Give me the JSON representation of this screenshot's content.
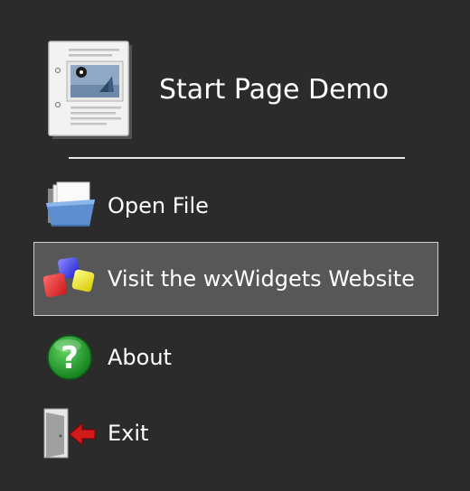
{
  "title": "Start Page Demo",
  "items": [
    {
      "label": "Open File",
      "icon": "folder-open-icon"
    },
    {
      "label": "Visit the wxWidgets Website",
      "icon": "wxwidgets-logo-icon",
      "hovered": true
    },
    {
      "label": "About",
      "icon": "help-question-icon"
    },
    {
      "label": "Exit",
      "icon": "exit-door-icon"
    }
  ],
  "colors": {
    "background": "#2b2b2b",
    "hover_background": "#575757",
    "hover_border": "#cfcfcf",
    "text": "#ffffff"
  }
}
